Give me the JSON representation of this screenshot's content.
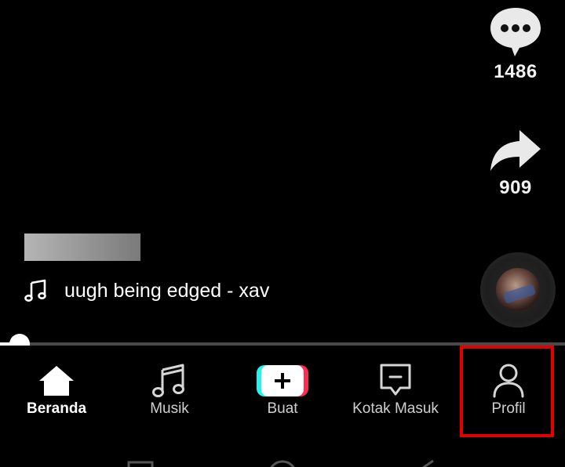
{
  "actions": {
    "comment_count": "1486",
    "share_count": "909"
  },
  "video": {
    "music_title": "uugh being edged - xav",
    "progress": 0.035
  },
  "tabs": [
    {
      "label": "Beranda",
      "icon": "home-icon",
      "active": true
    },
    {
      "label": "Musik",
      "icon": "music-icon",
      "active": false
    },
    {
      "label": "Buat",
      "icon": "plus-icon",
      "active": false
    },
    {
      "label": "Kotak Masuk",
      "icon": "inbox-icon",
      "active": false
    },
    {
      "label": "Profil",
      "icon": "person-icon",
      "active": false
    }
  ],
  "colors": {
    "background": "#000000",
    "highlight": "#e10000",
    "create_cyan": "#25f4ee",
    "create_red": "#fe2c55"
  }
}
